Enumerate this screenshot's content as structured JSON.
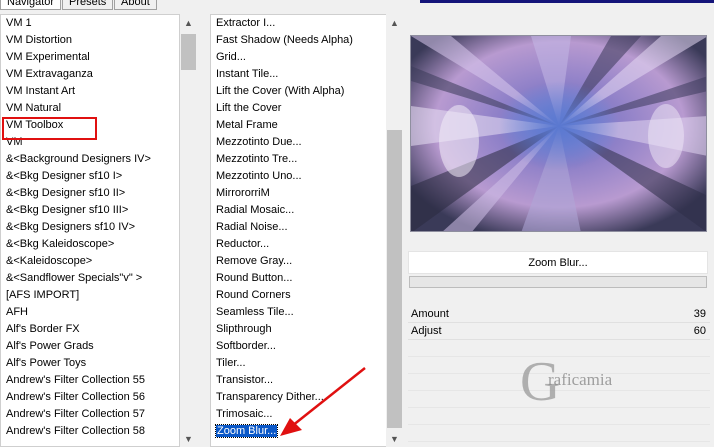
{
  "tabs": [
    "Navigator",
    "Presets",
    "About"
  ],
  "category_list": [
    "VM 1",
    "VM Distortion",
    "VM Experimental",
    "VM Extravaganza",
    "VM Instant Art",
    "VM Natural",
    "VM Toolbox",
    "VM",
    "&<Background Designers IV>",
    "&<Bkg Designer sf10 I>",
    "&<Bkg Designer sf10 II>",
    "&<Bkg Designer sf10 III>",
    "&<Bkg Designers sf10 IV>",
    "&<Bkg Kaleidoscope>",
    "&<Kaleidoscope>",
    "&<Sandflower Specials\"v\" >",
    "[AFS IMPORT]",
    "AFH",
    "Alf's Border FX",
    "Alf's Power Grads",
    "Alf's Power Toys",
    "Andrew's Filter Collection 55",
    "Andrew's Filter Collection 56",
    "Andrew's Filter Collection 57",
    "Andrew's Filter Collection 58"
  ],
  "filter_list": [
    "Extractor I...",
    "Fast Shadow (Needs Alpha)",
    "Grid...",
    "Instant Tile...",
    "Lift the Cover (With Alpha)",
    "Lift the Cover",
    "Metal Frame",
    "Mezzotinto Due...",
    "Mezzotinto Tre...",
    "Mezzotinto Uno...",
    "MirrororriM",
    "Radial Mosaic...",
    "Radial Noise...",
    "Reductor...",
    "Remove Gray...",
    "Round Button...",
    "Round Corners",
    "Seamless Tile...",
    "Slipthrough",
    "Softborder...",
    "Tiler...",
    "Transistor...",
    "Transparency Dither...",
    "Trimosaic...",
    "Zoom Blur..."
  ],
  "selected_filter": "Zoom Blur...",
  "highlighted_category": "VM Toolbox",
  "filter_name_button": "Zoom Blur...",
  "params": [
    {
      "label": "Amount",
      "value": "39"
    },
    {
      "label": "Adjust",
      "value": "60"
    }
  ],
  "watermark_text": "raficamia",
  "colors": {
    "selection": "#0a58c8",
    "highlight_box": "#e01010",
    "arrow": "#e01010"
  }
}
